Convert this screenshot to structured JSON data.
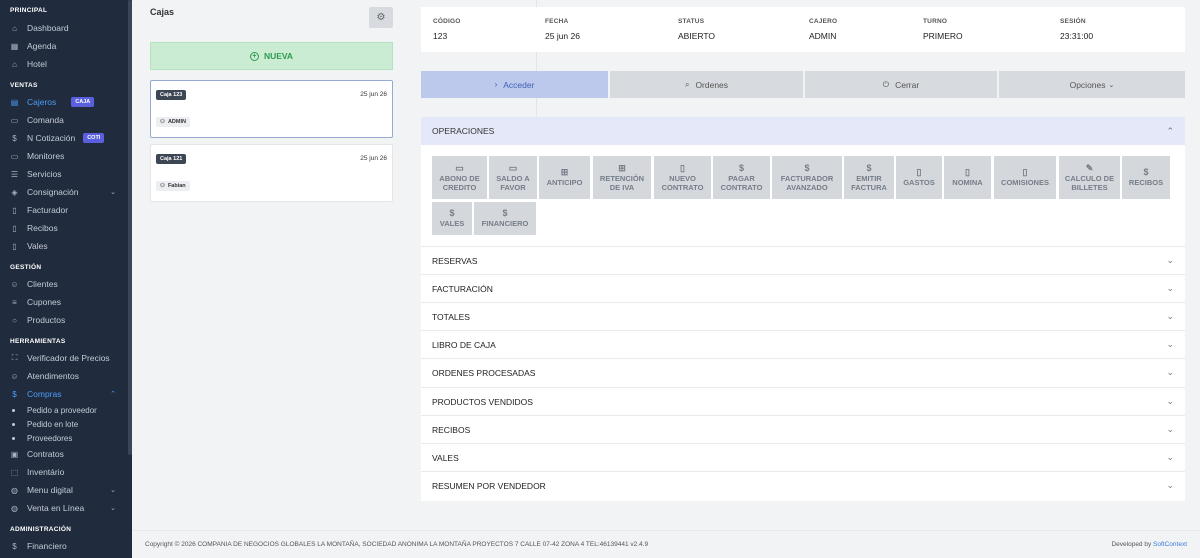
{
  "sidebar": {
    "sections": {
      "principal": "PRINCIPAL",
      "ventas": "VENTAS",
      "gestion": "GESTIÓN",
      "herramientas": "HERRAMIENTAS",
      "administracion": "ADMINISTRACIÓN"
    },
    "principal": [
      "Dashboard",
      "Agenda",
      "Hotel"
    ],
    "ventas": {
      "cajeros": "Cajeros",
      "cajeros_badge": "CAJA",
      "comanda": "Comanda",
      "ncotizacion": "N Cotización",
      "ncotizacion_badge": "COTI",
      "monitores": "Monitores",
      "servicios": "Servicios",
      "consignacion": "Consignación",
      "facturador": "Facturador",
      "recibos": "Recibos",
      "vales": "Vales"
    },
    "gestion": [
      "Clientes",
      "Cupones",
      "Productos"
    ],
    "herramientas": {
      "verificador": "Verificador de Precios",
      "atendimientos": "Atendimentos",
      "compras": "Compras",
      "compras_sub": [
        "Pedido a proveedor",
        "Pedido en lote",
        "Proveedores"
      ],
      "contratos": "Contratos",
      "inventario": "Inventário",
      "menu_digital": "Menu digital",
      "venta_linea": "Venta en Línea"
    },
    "administracion": {
      "financiero": "Financiero"
    }
  },
  "cajas": {
    "title": "Cajas",
    "new_label": "NUEVA",
    "items": [
      {
        "tag": "Caja 123",
        "date": "25 jun 26",
        "user": "ADMIN"
      },
      {
        "tag": "Caja 121",
        "date": "25 jun 26",
        "user": "Fabian"
      }
    ]
  },
  "session_info": {
    "codigo_label": "CÓDIGO",
    "codigo": "123",
    "fecha_label": "FECHA",
    "fecha": "25 jun 26",
    "status_label": "STATUS",
    "status": "ABIERTO",
    "cajero_label": "CAJERO",
    "cajero": "ADMIN",
    "turno_label": "TURNO",
    "turno": "PRIMERO",
    "sesion_label": "SESIÓN",
    "sesion": "23:31:00"
  },
  "actions": {
    "acceder": "Acceder",
    "ordenes": "Ordenes",
    "cerrar": "Cerrar",
    "opciones": "Opciones"
  },
  "operaciones": {
    "title": "OPERACIONES",
    "buttons": [
      {
        "l1": "ABONO DE",
        "l2": "CREDITO"
      },
      {
        "l1": "SALDO A",
        "l2": "FAVOR"
      },
      {
        "l1": "ANTICIPO",
        "l2": ""
      },
      {
        "l1": "RETENCIÓN",
        "l2": "DE IVA"
      },
      {
        "l1": "NUEVO",
        "l2": "CONTRATO"
      },
      {
        "l1": "PAGAR",
        "l2": "CONTRATO"
      },
      {
        "l1": "FACTURADOR",
        "l2": "AVANZADO"
      },
      {
        "l1": "EMITIR",
        "l2": "FACTURA"
      },
      {
        "l1": "GASTOS",
        "l2": ""
      },
      {
        "l1": "NOMINA",
        "l2": ""
      },
      {
        "l1": "COMISIONES",
        "l2": ""
      },
      {
        "l1": "CALCULO DE",
        "l2": "BILLETES"
      },
      {
        "l1": "RECIBOS",
        "l2": ""
      },
      {
        "l1": "VALES",
        "l2": ""
      },
      {
        "l1": "FINANCIERO",
        "l2": ""
      }
    ]
  },
  "sections": [
    "RESERVAS",
    "FACTURACIÓN",
    "TOTALES",
    "LIBRO DE CAJA",
    "ORDENES PROCESADAS",
    "PRODUCTOS VENDIDOS",
    "RECIBOS",
    "VALES",
    "RESUMEN POR VENDEDOR"
  ],
  "footer": {
    "copyright": "Copyright © 2026 COMPANIA DE NEGOCIOS GLOBALES LA MONTAÑA, SOCIEDAD ANONIMA LA MONTAÑA PROYECTOS 7 CALLE 07-42 ZONA 4 TEL:46139441 v2.4.9",
    "developed_by": "Developed by",
    "developer": "SoftContext"
  }
}
